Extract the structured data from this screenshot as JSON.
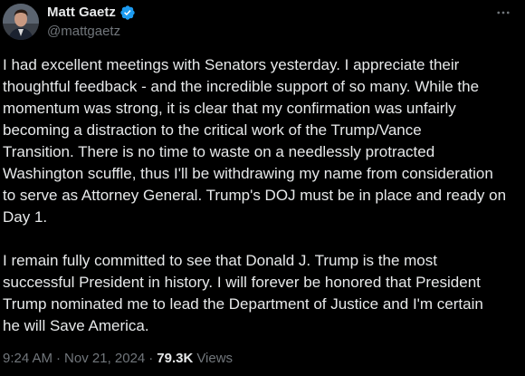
{
  "author": {
    "display_name": "Matt Gaetz",
    "handle": "@mattgaetz",
    "verified": true,
    "verified_color": "#1d9bf0"
  },
  "more_icon": "more-horizontal-icon",
  "tweet": {
    "paragraphs": [
      "I had excellent meetings with Senators yesterday.  I appreciate their\nthoughtful feedback - and the incredible support of so many.  While the\nmomentum was strong, it is clear that my confirmation was unfairly\nbecoming a distraction to the critical work of the Trump/Vance\nTransition.  There is no time to waste on a needlessly protracted\nWashington scuffle, thus I'll be withdrawing my name from consideration\nto serve as Attorney General.  Trump's DOJ must be in place and ready on\nDay 1.",
      "I remain fully committed to see that Donald J. Trump is the most\nsuccessful President in history.  I will forever be honored that President\nTrump nominated me to lead the Department of Justice and I'm certain\nhe will Save America."
    ]
  },
  "meta": {
    "time": "9:24 AM",
    "separator": "·",
    "date": "Nov 21, 2024",
    "views_count": "79.3K",
    "views_label": "Views"
  },
  "colors": {
    "background": "#000000",
    "text": "#e7e9ea",
    "secondary": "#71767b",
    "accent": "#1d9bf0"
  }
}
